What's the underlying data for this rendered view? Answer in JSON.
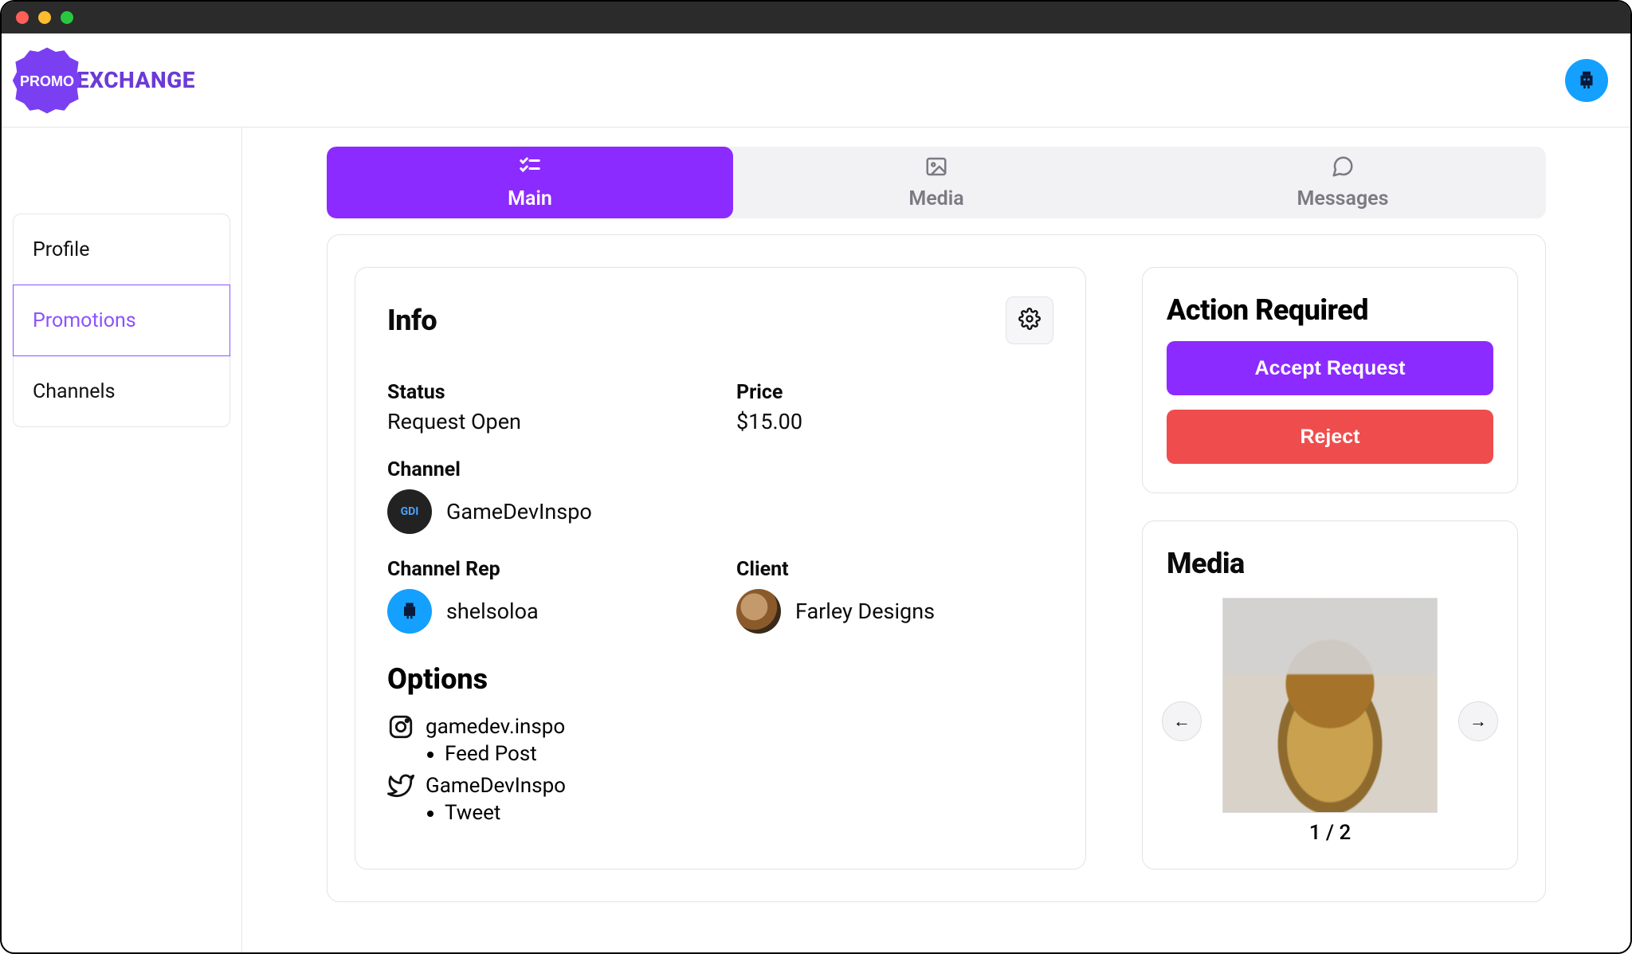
{
  "brand": {
    "name": "PROMO",
    "suffix": "EXCHANGE"
  },
  "sidebar": {
    "items": [
      {
        "label": "Profile",
        "active": false
      },
      {
        "label": "Promotions",
        "active": true
      },
      {
        "label": "Channels",
        "active": false
      }
    ]
  },
  "tabs": [
    {
      "label": "Main",
      "icon": "checklist",
      "active": true
    },
    {
      "label": "Media",
      "icon": "image",
      "active": false
    },
    {
      "label": "Messages",
      "icon": "chat",
      "active": false
    }
  ],
  "info": {
    "title": "Info",
    "status_label": "Status",
    "status_value": "Request Open",
    "price_label": "Price",
    "price_value": "$15.00",
    "channel_label": "Channel",
    "channel_name": "GameDevInspo",
    "channel_avatar_text": "GDI",
    "rep_label": "Channel Rep",
    "rep_name": "shelsoloa",
    "client_label": "Client",
    "client_name": "Farley Designs",
    "options_title": "Options",
    "options": [
      {
        "platform": "instagram",
        "handle": "gamedev.inspo",
        "sub": "Feed Post"
      },
      {
        "platform": "twitter",
        "handle": "GameDevInspo",
        "sub": "Tweet"
      }
    ]
  },
  "actions": {
    "title": "Action Required",
    "accept_label": "Accept Request",
    "reject_label": "Reject"
  },
  "media": {
    "title": "Media",
    "pager": "1 / 2"
  }
}
